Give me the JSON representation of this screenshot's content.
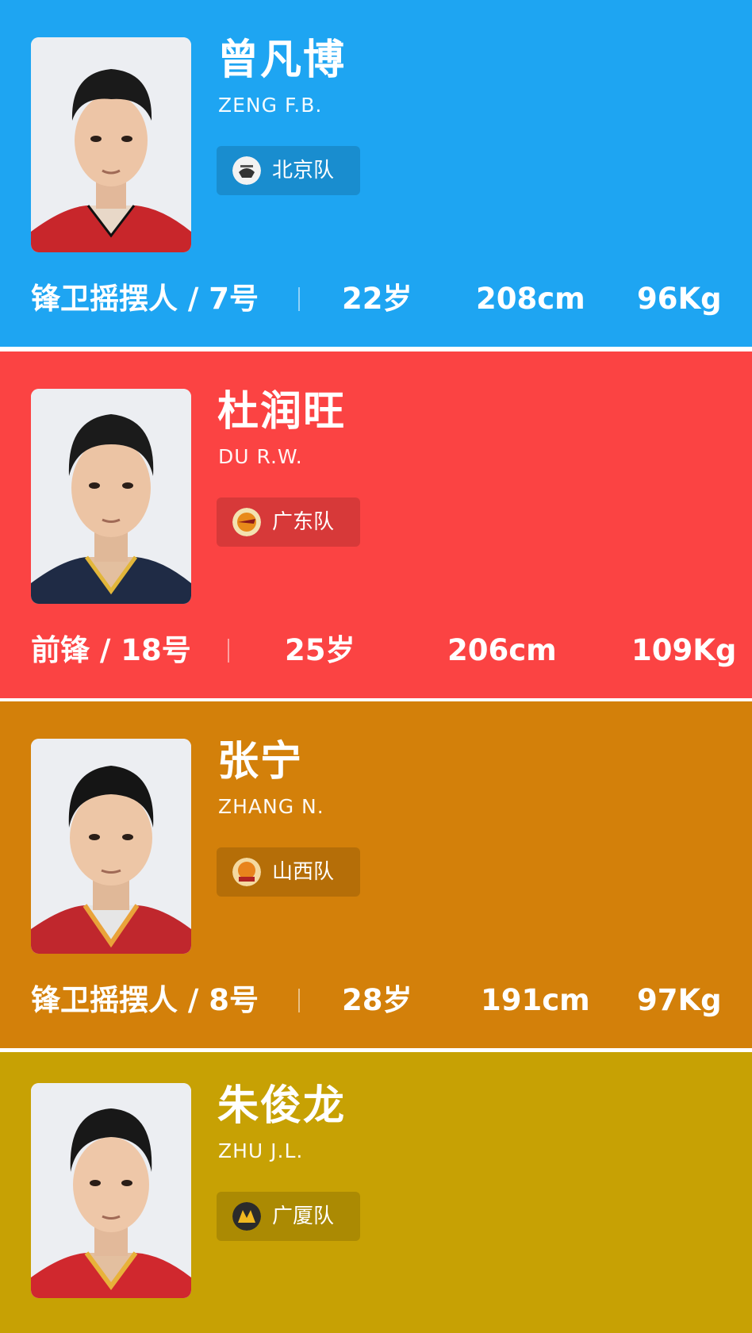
{
  "players": [
    {
      "name_cn": "曾凡博",
      "name_en": "ZENG F.B.",
      "team": "北京队",
      "position": "锋卫摇摆人 / 7号",
      "age": "22岁",
      "height": "208cm",
      "weight": "96Kg",
      "card_color": "#1ea5f2",
      "jersey_color": "#c8262b"
    },
    {
      "name_cn": "杜润旺",
      "name_en": "DU R.W.",
      "team": "广东队",
      "position": "前锋 / 18号",
      "age": "25岁",
      "height": "206cm",
      "weight": "109Kg",
      "card_color": "#fb4343",
      "jersey_color": "#1f2b45"
    },
    {
      "name_cn": "张宁",
      "name_en": "ZHANG N.",
      "team": "山西队",
      "position": "锋卫摇摆人 / 8号",
      "age": "28岁",
      "height": "191cm",
      "weight": "97Kg",
      "card_color": "#d3800a",
      "jersey_color": "#c0272d"
    },
    {
      "name_cn": "朱俊龙",
      "name_en": "ZHU J.L.",
      "team": "广厦队",
      "position": "",
      "age": "",
      "height": "",
      "weight": "",
      "card_color": "#c7a104",
      "jersey_color": "#d0282e"
    }
  ]
}
